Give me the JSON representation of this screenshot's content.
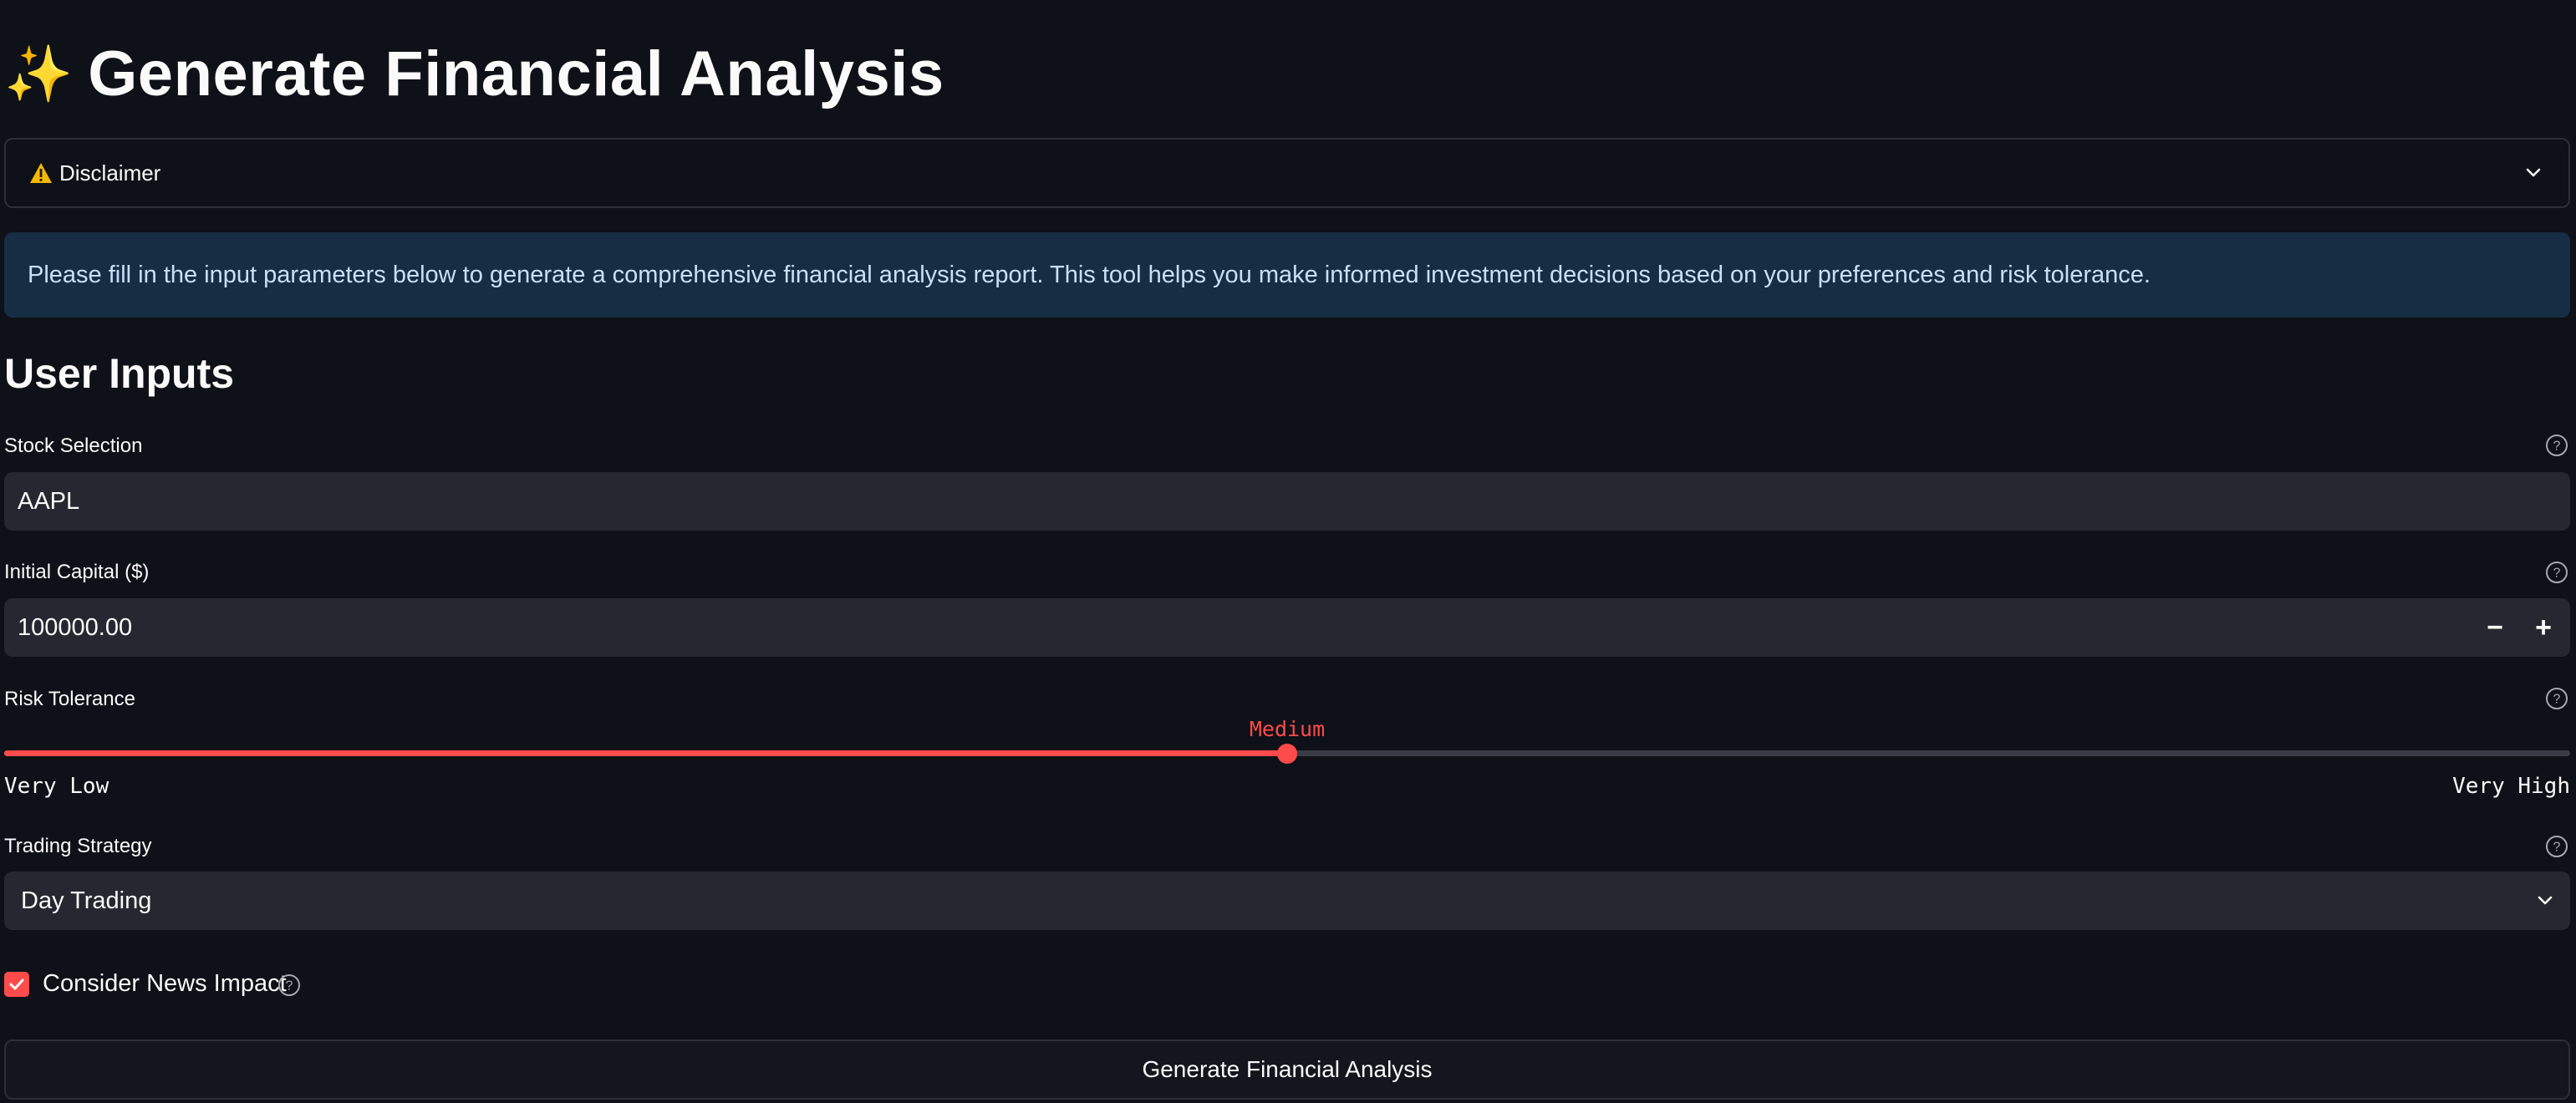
{
  "header": {
    "icon": "sparkles-icon",
    "title": "Generate Financial Analysis"
  },
  "disclaimer": {
    "icon": "warning-icon",
    "label": "Disclaimer",
    "expanded": false
  },
  "info": {
    "text": "Please fill in the input parameters below to generate a comprehensive financial analysis report. This tool helps you make informed investment decisions based on your preferences and risk tolerance."
  },
  "inputs": {
    "heading": "User Inputs",
    "stock": {
      "label": "Stock Selection",
      "value": "AAPL"
    },
    "capital": {
      "label": "Initial Capital ($)",
      "value": "100000.00",
      "decrement": "−",
      "increment": "+"
    },
    "risk": {
      "label": "Risk Tolerance",
      "value": "Medium",
      "min": "Very Low",
      "max": "Very High",
      "level": 0.5
    },
    "strategy": {
      "label": "Trading Strategy",
      "value": "Day Trading"
    },
    "news": {
      "label": "Consider News Impact",
      "checked": true
    }
  },
  "actions": {
    "generate_label": "Generate Financial Analysis"
  },
  "colors": {
    "accent": "#ff4b4b",
    "background": "#0e1117",
    "info_background": "#172d43",
    "input_background": "#262730"
  }
}
